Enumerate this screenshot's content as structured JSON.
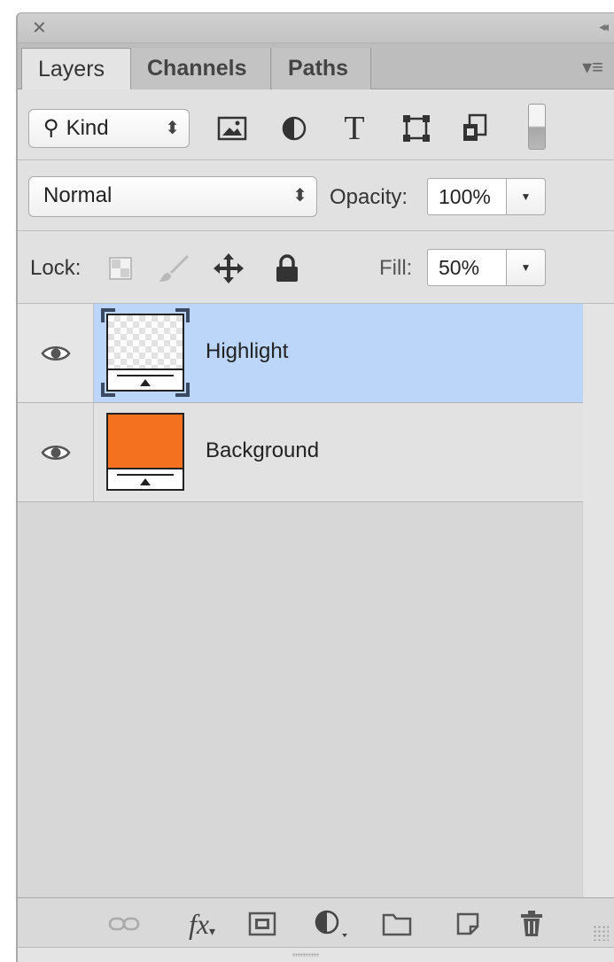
{
  "panel": {
    "close_icon": "close-icon",
    "collapse_icon": "double-chevron-left-icon",
    "menu_icon": "panel-menu-icon"
  },
  "tabs": [
    {
      "label": "Layers",
      "active": true
    },
    {
      "label": "Channels",
      "active": false
    },
    {
      "label": "Paths",
      "active": false
    }
  ],
  "filter": {
    "kind_label": "Kind",
    "icons": [
      "pixel-layer-filter-icon",
      "adjustment-layer-filter-icon",
      "type-layer-filter-icon",
      "shape-layer-filter-icon",
      "smart-object-filter-icon"
    ],
    "type_glyph": "T"
  },
  "blend": {
    "mode": "Normal",
    "opacity_label": "Opacity:",
    "opacity_value": "100%"
  },
  "lock": {
    "label": "Lock:",
    "icons": [
      "lock-transparent-pixels-icon",
      "lock-image-pixels-icon",
      "lock-position-icon",
      "lock-all-icon"
    ],
    "fill_label": "Fill:",
    "fill_value": "50%"
  },
  "layers": [
    {
      "name": "Highlight",
      "visible": true,
      "selected": true,
      "thumbnail": "transparent"
    },
    {
      "name": "Background",
      "visible": true,
      "selected": false,
      "thumbnail": "orange",
      "thumbnail_color": "#f4711f"
    }
  ],
  "colors": {
    "selected_row": "#bcd6f9",
    "thumbnail_orange": "#f4711f"
  },
  "bottom_toolbar": {
    "fx_label": "fx",
    "icons": [
      "link-layers-icon",
      "layer-style-fx-icon",
      "add-mask-icon",
      "new-adjustment-layer-icon",
      "new-group-folder-icon",
      "new-layer-icon",
      "delete-layer-trash-icon"
    ]
  }
}
